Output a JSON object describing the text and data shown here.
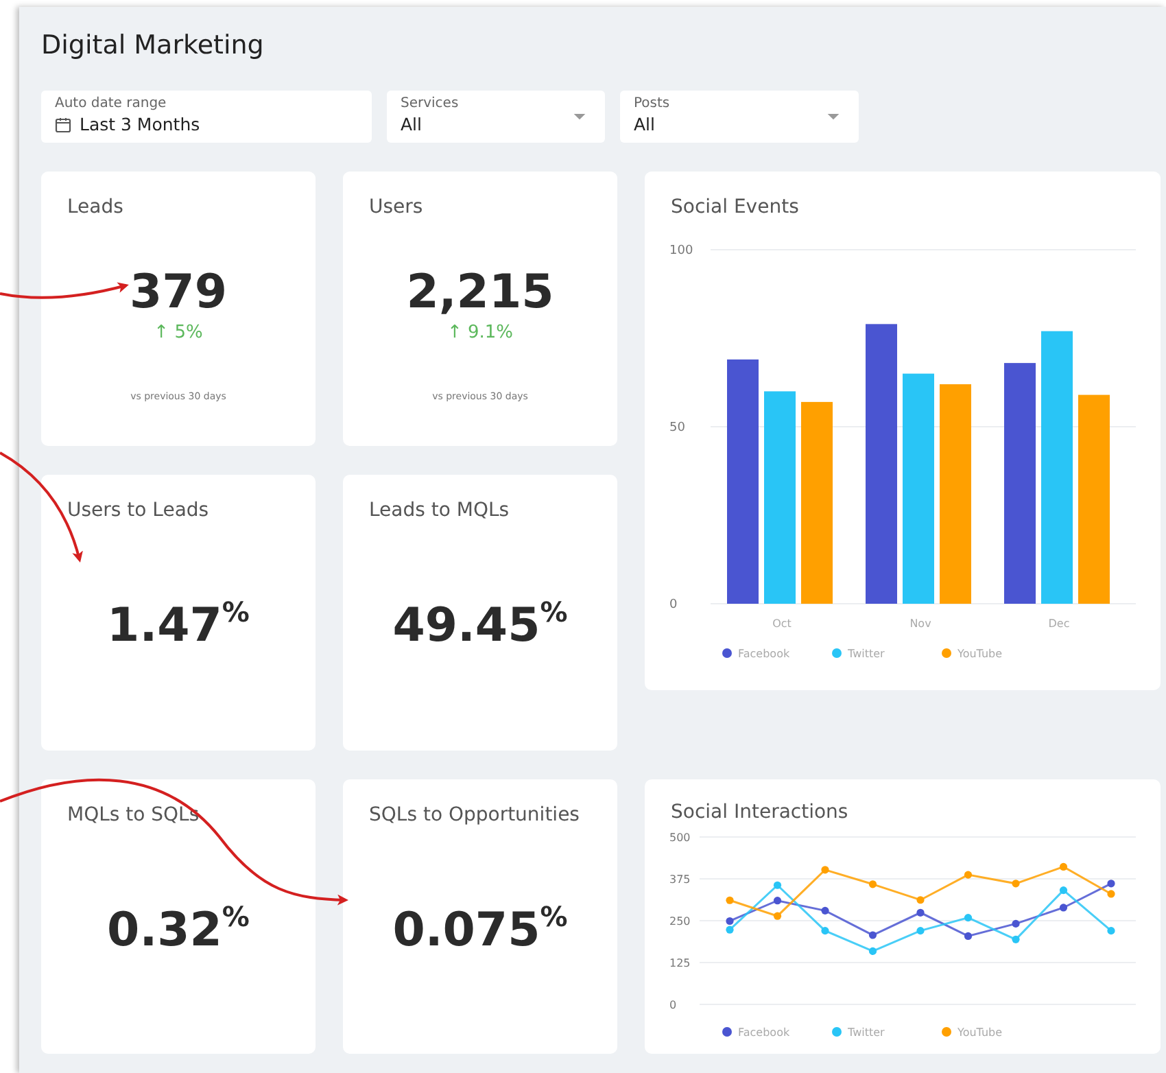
{
  "title": "Digital Marketing",
  "filters": [
    {
      "kind": "date",
      "label": "Auto date range",
      "value": "Last 3 Months"
    },
    {
      "kind": "select",
      "label": "Services",
      "value": "All"
    },
    {
      "kind": "select",
      "label": "Posts",
      "value": "All"
    }
  ],
  "kpis": [
    {
      "title": "Leads",
      "value": "379",
      "change": "↑ 5%",
      "note": "vs previous 30 days"
    },
    {
      "title": "Users",
      "value": "2,215",
      "change": "↑ 9.1%",
      "note": "vs previous 30 days"
    },
    {
      "title": "Users to Leads",
      "value": "1.47$^{%}$"
    },
    {
      "title": "Leads to MQLs",
      "value": "49.45$^{%}$"
    },
    {
      "title": "MQLs to SQLs",
      "value": "0.32$^{%}$"
    },
    {
      "title": "SQLs to Opportunities",
      "value": "0.075$^{%}$"
    }
  ],
  "social_events": {
    "chart_data": {
      "type": "bar",
      "title": "Social Events",
      "categories": [
        "Oct",
        "Nov",
        "Dec"
      ],
      "yticks": [
        0,
        50,
        100
      ],
      "ylim": [
        0,
        100
      ],
      "grid": true,
      "legend": true,
      "series": [
        {
          "name": "Facebook",
          "color": "#4a55d1",
          "values": [
            69,
            79,
            68
          ]
        },
        {
          "name": "Twitter",
          "color": "#29c5f6",
          "values": [
            60,
            65,
            77
          ]
        },
        {
          "name": "YouTube",
          "color": "#ffa000",
          "values": [
            57,
            62,
            59
          ]
        }
      ]
    }
  },
  "social_interactions": {
    "chart_data": {
      "type": "line",
      "title": "Social Interactions",
      "yticks": [
        0,
        125,
        250,
        375,
        500
      ],
      "ylim": [
        0,
        500
      ],
      "grid": true,
      "legend": true,
      "series": [
        {
          "name": "Facebook",
          "color": "#4a55d1",
          "marker": true,
          "values": [
            249,
            310,
            280,
            207,
            274,
            204,
            241,
            289,
            361
          ]
        },
        {
          "name": "Twitter",
          "color": "#29c5f6",
          "marker": true,
          "values": [
            223,
            356,
            220,
            159,
            220,
            259,
            194,
            341,
            220
          ]
        },
        {
          "name": "YouTube",
          "color": "#ffa000",
          "marker": true,
          "values": [
            311,
            264,
            402,
            359,
            312,
            387,
            361,
            411,
            330
          ]
        }
      ]
    }
  }
}
